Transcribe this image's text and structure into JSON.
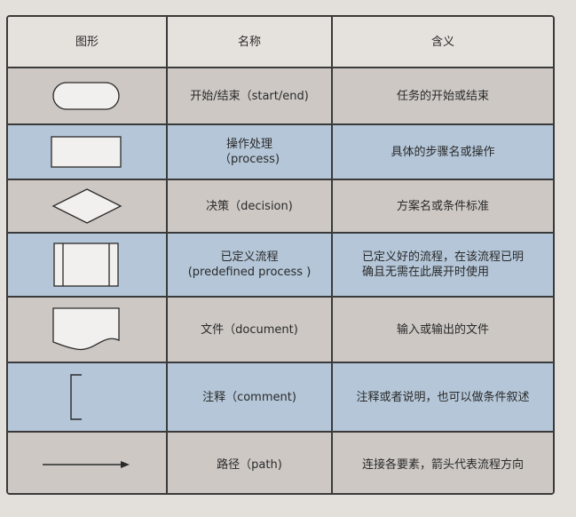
{
  "header": {
    "col1": "图形",
    "col2": "名称",
    "col3": "含义"
  },
  "rows": [
    {
      "shape": "terminator",
      "name": [
        "开始/结束（start/end)"
      ],
      "meaning": [
        "任务的开始或结束"
      ]
    },
    {
      "shape": "process",
      "name": [
        "操作处理",
        "（process)"
      ],
      "meaning": [
        "具体的步骤名或操作"
      ]
    },
    {
      "shape": "decision",
      "name": [
        "决策（decision)"
      ],
      "meaning": [
        "方案名或条件标准"
      ]
    },
    {
      "shape": "predefined-process",
      "name": [
        "已定义流程",
        "(predefined process )"
      ],
      "meaning": [
        "已定义好的流程，在该流程已明",
        "确且无需在此展开时使用"
      ]
    },
    {
      "shape": "document",
      "name": [
        "文件（document)"
      ],
      "meaning": [
        "输入或输出的文件"
      ]
    },
    {
      "shape": "comment",
      "name": [
        "注释（comment)"
      ],
      "meaning": [
        "注释或者说明，也可以做条件叙述"
      ]
    },
    {
      "shape": "path",
      "name": [
        "路径（path)"
      ],
      "meaning": [
        "连接各要素，箭头代表流程方向"
      ]
    }
  ],
  "colors": {
    "gray_row": "#cdc8c4",
    "blue_row": "#b4c6d8",
    "header": "#e5e2de",
    "border": "#3a3a3a",
    "background": "#e3dfdb"
  }
}
